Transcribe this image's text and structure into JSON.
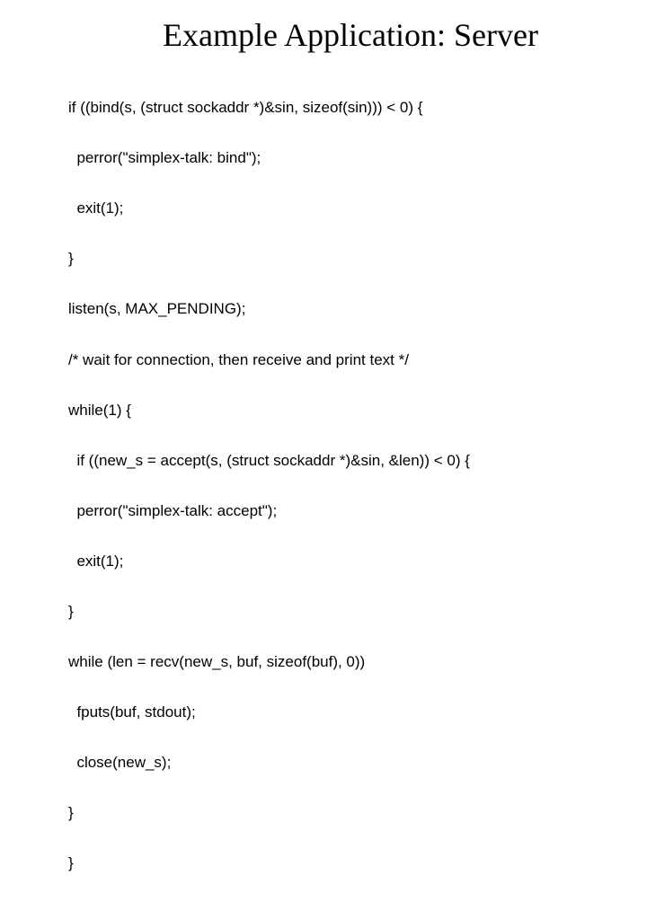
{
  "title": "Example Application: Server",
  "code": {
    "l01": "if ((bind(s, (struct sockaddr *)&sin, sizeof(sin))) < 0) {",
    "l02": "  perror(\"simplex-talk: bind\");",
    "l03": "  exit(1);",
    "l04": "}",
    "l05": "listen(s, MAX_PENDING);",
    "l06": "/* wait for connection, then receive and print text */",
    "l07": "while(1) {",
    "l08": "  if ((new_s = accept(s, (struct sockaddr *)&sin, &len)) < 0) {",
    "l09": "  perror(\"simplex-talk: accept\");",
    "l10": "  exit(1);",
    "l11": "}",
    "l12": "while (len = recv(new_s, buf, sizeof(buf), 0))",
    "l13": "  fputs(buf, stdout);",
    "l14": "  close(new_s);",
    "l15": "}",
    "l16": "}"
  }
}
